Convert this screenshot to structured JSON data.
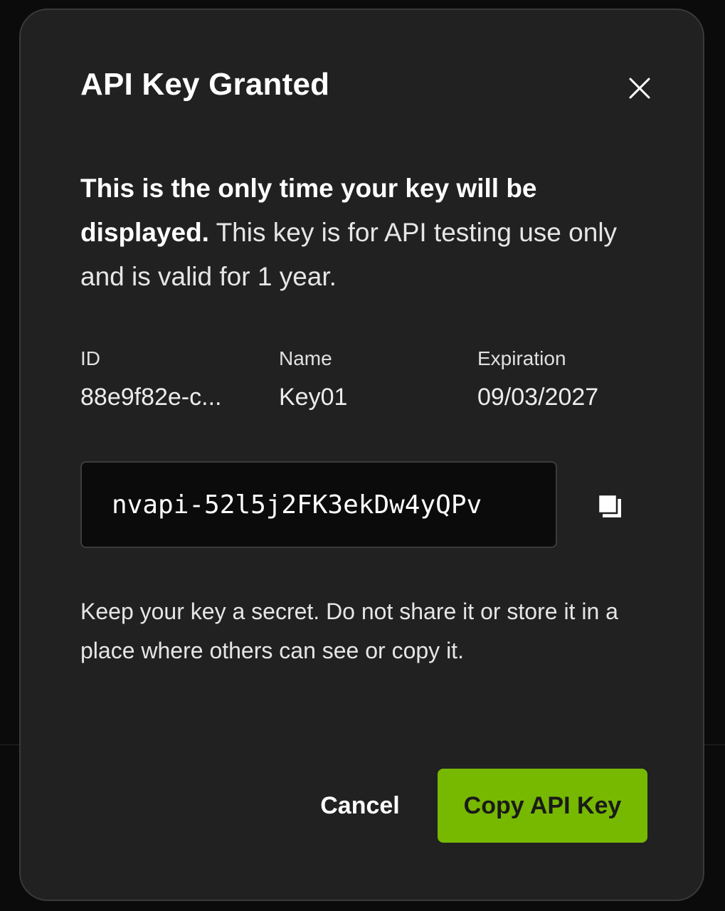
{
  "dialog": {
    "title": "API Key Granted",
    "warning_bold": "This is the only time your key will be displayed.",
    "warning_text": " This key is for API testing use only and is valid for 1 year.",
    "meta": {
      "id_label": "ID",
      "id_value": "88e9f82e-c...",
      "name_label": "Name",
      "name_value": "Key01",
      "expiration_label": "Expiration",
      "expiration_value": "09/03/2027"
    },
    "api_key_value": "nvapi-52l5j2FK3ekDw4yQPv",
    "notice": "Keep your key a secret. Do not share it or store it in a place where others can see or copy it.",
    "cancel_label": "Cancel",
    "copy_label": "Copy API Key"
  },
  "icons": {
    "close": "close-icon",
    "copy": "copy-icon"
  },
  "colors": {
    "background": "#0b0b0b",
    "dialog": "#212121",
    "accent": "#76b900",
    "key_field": "#0b0b0b"
  }
}
